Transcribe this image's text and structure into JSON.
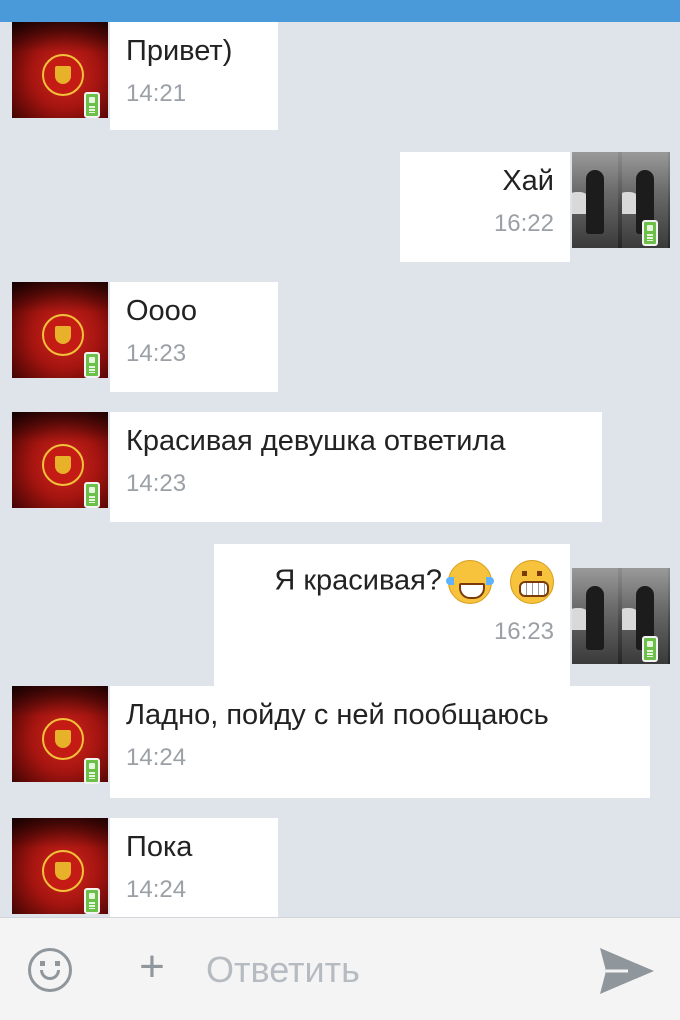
{
  "messages": [
    {
      "direction": "in",
      "text": "Привет)",
      "time": "14:21"
    },
    {
      "direction": "out",
      "text": "Хай",
      "time": "16:22"
    },
    {
      "direction": "in",
      "text": "Оооо",
      "time": "14:23"
    },
    {
      "direction": "in",
      "text": "Красивая девушка ответила",
      "time": "14:23"
    },
    {
      "direction": "out",
      "text": "Я красивая?",
      "emojis": [
        "face-with-tears-of-joy",
        "grinning-face"
      ],
      "time": "16:23"
    },
    {
      "direction": "in",
      "text": "Ладно, пойду с ней пообщаюсь",
      "time": "14:24"
    },
    {
      "direction": "in",
      "text": "Пока",
      "time": "14:24"
    }
  ],
  "composer": {
    "placeholder": "Ответить",
    "icons": [
      "smiley-icon",
      "plus-icon",
      "send-icon"
    ]
  },
  "colors": {
    "top_bar": "#4a9ad9",
    "chat_background": "#dfe4ea",
    "bubble": "#ffffff",
    "time_text": "#9aa0a6",
    "mobile_badge": "#6cc04a"
  }
}
